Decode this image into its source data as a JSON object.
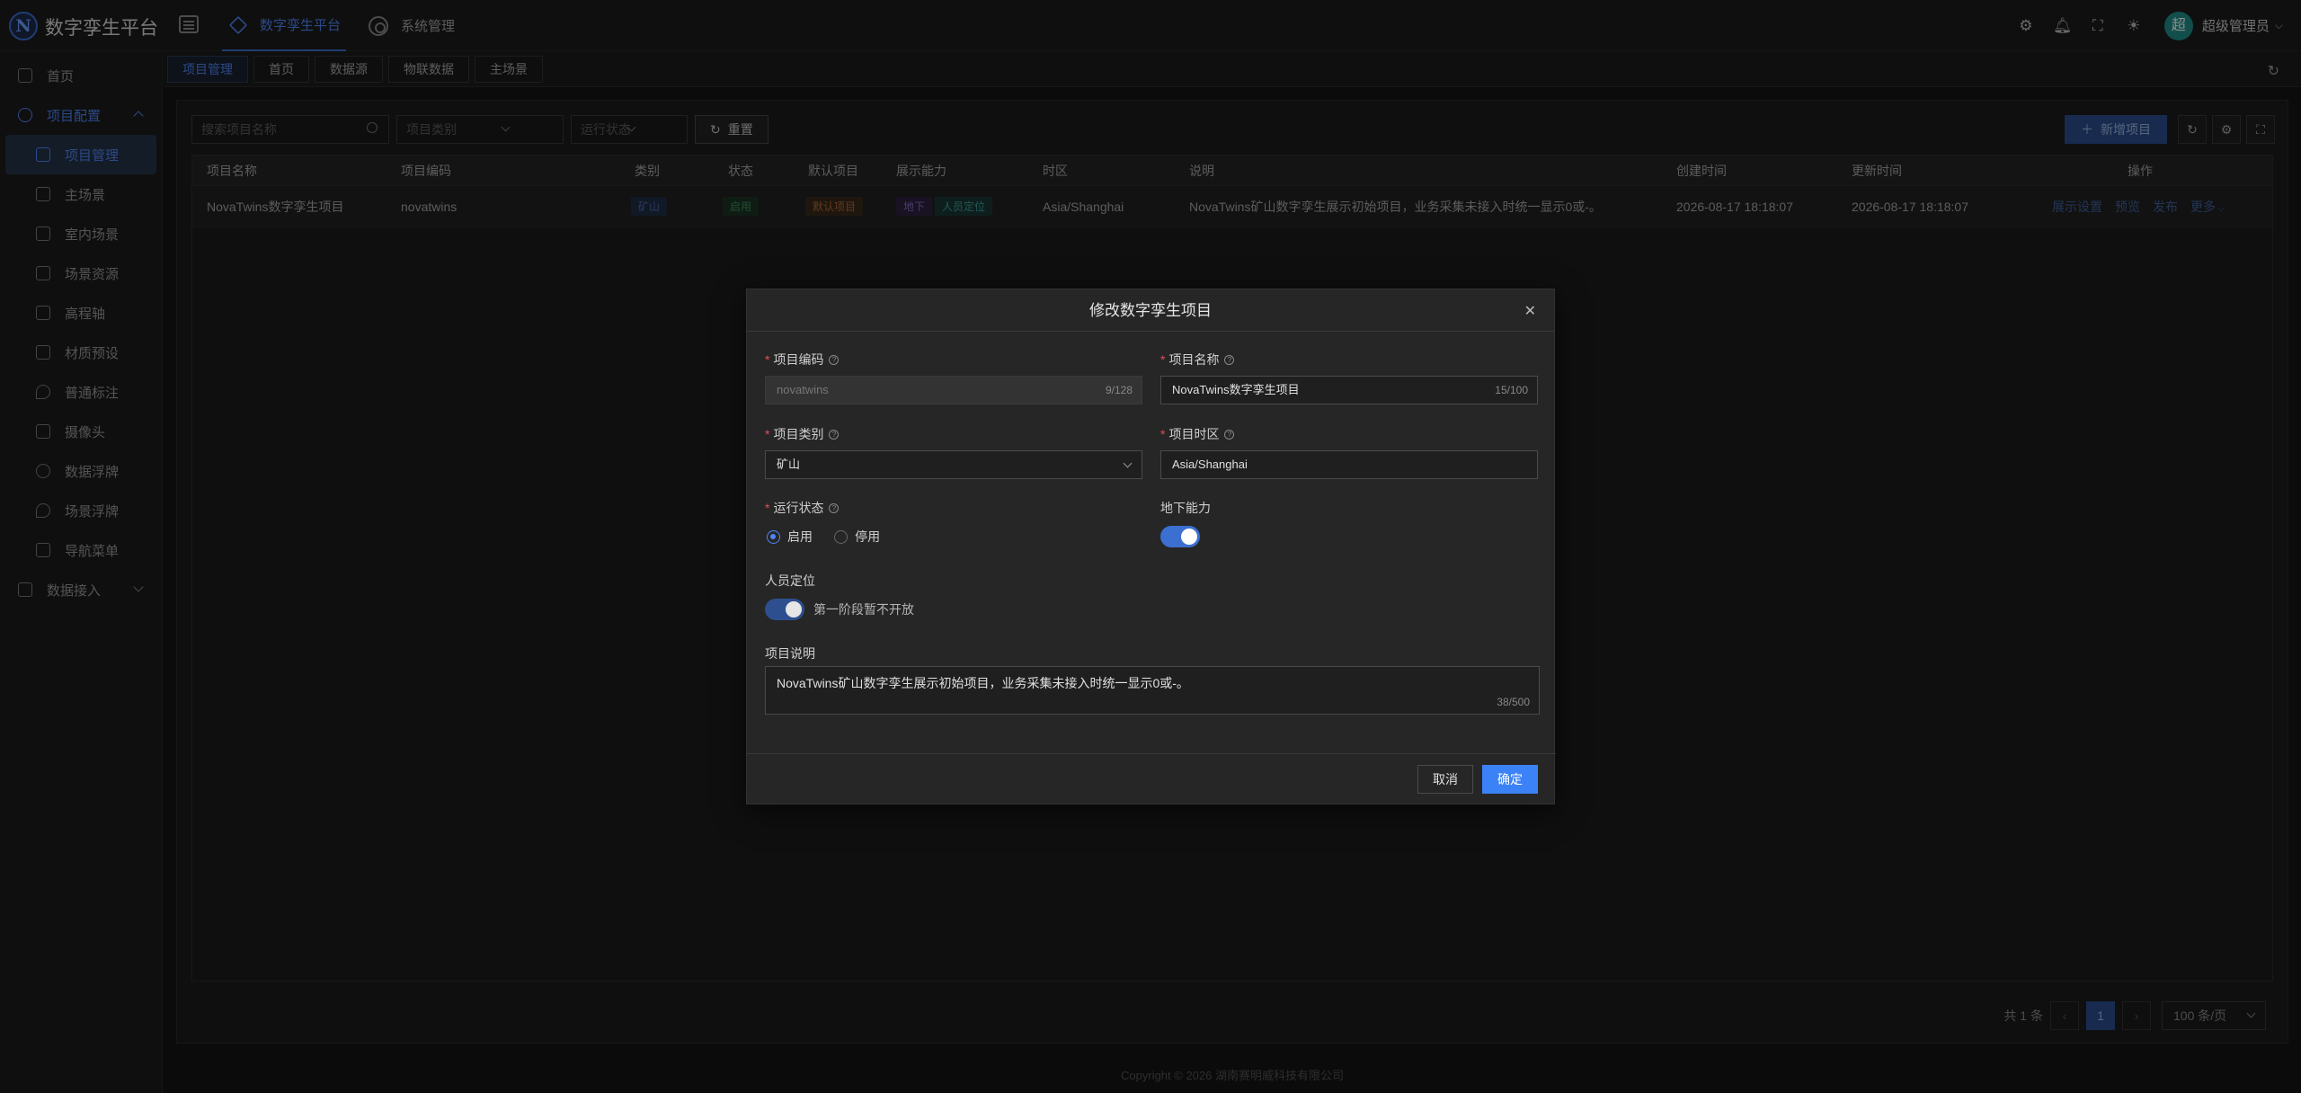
{
  "app": {
    "logo_letter": "N",
    "title": "数字孪生平台"
  },
  "topnav": [
    {
      "label": "数字孪生平台",
      "icon": "layers-icon"
    },
    {
      "label": "系统管理",
      "icon": "gear-icon"
    }
  ],
  "user": {
    "avatar_char": "超",
    "name": "超级管理员"
  },
  "sidebar": {
    "items": [
      {
        "label": "首页"
      },
      {
        "label": "项目配置"
      },
      {
        "label": "项目管理"
      },
      {
        "label": "主场景"
      },
      {
        "label": "室内场景"
      },
      {
        "label": "场景资源"
      },
      {
        "label": "高程轴"
      },
      {
        "label": "材质预设"
      },
      {
        "label": "普通标注"
      },
      {
        "label": "摄像头"
      },
      {
        "label": "数据浮牌"
      },
      {
        "label": "场景浮牌"
      },
      {
        "label": "导航菜单"
      },
      {
        "label": "数据接入"
      }
    ]
  },
  "tabs": [
    "项目管理",
    "首页",
    "数据源",
    "物联数据",
    "主场景"
  ],
  "filters": {
    "search_placeholder": "搜索项目名称",
    "category_placeholder": "项目类别",
    "status_placeholder": "运行状态",
    "reset_label": "重置"
  },
  "toolbar": {
    "add_label": "新增项目"
  },
  "table": {
    "headers": [
      "项目名称",
      "项目编码",
      "类别",
      "状态",
      "默认项目",
      "展示能力",
      "时区",
      "说明",
      "创建时间",
      "更新时间",
      "操作"
    ],
    "rows": [
      {
        "name": "NovaTwins数字孪生项目",
        "code": "novatwins",
        "category": "矿山",
        "status": "启用",
        "default": "默认项目",
        "cap1": "地下",
        "cap2": "人员定位",
        "tz": "Asia/Shanghai",
        "desc": "NovaTwins矿山数字孪生展示初始项目，业务采集未接入时统一显示0或-。",
        "created": "2026-08-17 18:18:07",
        "updated": "2026-08-17 18:18:07",
        "act1": "展示设置",
        "act2": "预览",
        "act3": "发布",
        "act4": "更多"
      }
    ]
  },
  "pager": {
    "total": "共 1 条",
    "page": "1",
    "size": "100 条/页"
  },
  "footer": "Copyright © 2026 湖南赛明威科技有限公司",
  "modal": {
    "title": "修改数字孪生项目",
    "code_label": "项目编码",
    "code_value": "novatwins",
    "code_count": "9/128",
    "name_label": "项目名称",
    "name_value": "NovaTwins数字孪生项目",
    "name_count": "15/100",
    "cat_label": "项目类别",
    "cat_value": "矿山",
    "tz_label": "项目时区",
    "tz_value": "Asia/Shanghai",
    "status_label": "运行状态",
    "status_on": "启用",
    "status_off": "停用",
    "underground_label": "地下能力",
    "underground_enabled": true,
    "person_label": "人员定位",
    "person_enabled": true,
    "person_note": "第一阶段暂不开放",
    "desc_label": "项目说明",
    "desc_value": "NovaTwins矿山数字孪生展示初始项目，业务采集未接入时统一显示0或-。",
    "desc_count": "38/500",
    "cancel_label": "取消",
    "ok_label": "确定"
  }
}
